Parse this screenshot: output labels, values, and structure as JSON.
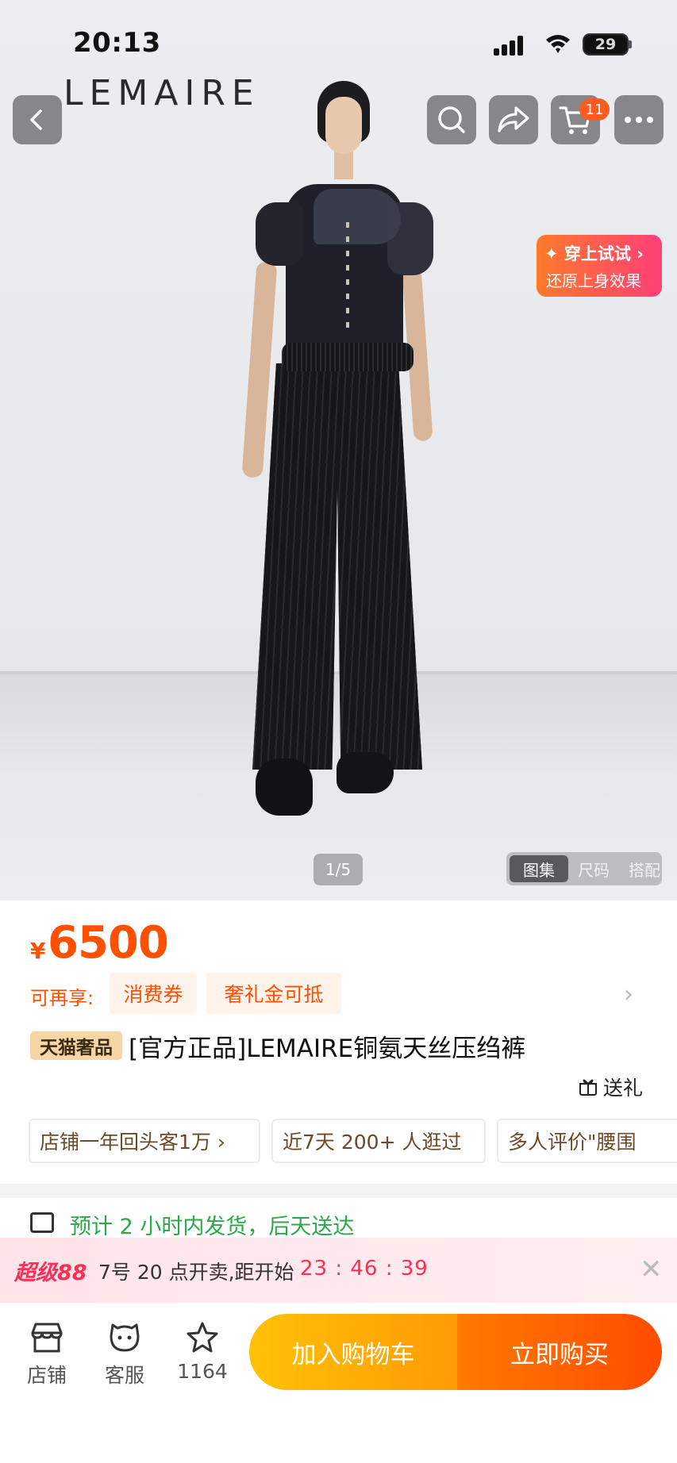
{
  "status_bar": {
    "time": "20:13",
    "battery": "29"
  },
  "header": {
    "brand": "LEMAIRE",
    "cart_count": "11"
  },
  "tryon": {
    "title": "✦ 穿上试试 ›",
    "subtitle": "还原上身效果"
  },
  "gallery": {
    "pager": "1/5",
    "tabs": [
      "图集",
      "尺码",
      "搭配"
    ],
    "active_tab": "图集"
  },
  "price": {
    "currency": "¥",
    "amount": "6500"
  },
  "benefits": {
    "label": "可再享:",
    "chips": [
      "消费券",
      "奢礼金可抵"
    ]
  },
  "product": {
    "tag": "天猫奢品",
    "title": "[官方正品]LEMAIRE铜氨天丝压绉裤",
    "gift_label": "送礼"
  },
  "highlights": [
    "店铺一年回头客1万 ›",
    "近7天 200+ 人逛过",
    "多人评价\"腰围"
  ],
  "shipping": {
    "text": "预计 2 小时内发货，后天送达"
  },
  "promo": {
    "logo": "超级88",
    "text": "7号 20 点开卖,距开始",
    "countdown": "23 : 46 : 39"
  },
  "bottom_bar": {
    "store_label": "店铺",
    "service_label": "客服",
    "favorites_count": "1164",
    "add_to_cart": "加入购物车",
    "buy_now": "立即购买"
  },
  "colors": {
    "accent": "#ff5000",
    "promo": "#ff2e55",
    "cart_btn": "#ffb300",
    "buy_btn": "#ff5a00"
  }
}
